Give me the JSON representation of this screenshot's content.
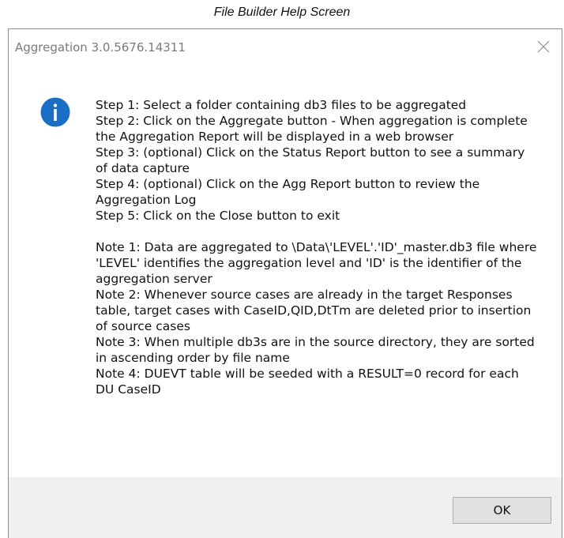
{
  "caption": "File Builder Help Screen",
  "window": {
    "title": "Aggregation 3.0.5676.14311",
    "close_icon": "close-icon"
  },
  "message": {
    "icon": "info-icon",
    "text": "Step 1: Select a folder containing db3 files to be aggregated\nStep 2: Click on the Aggregate button - When aggregation is complete the Aggregation Report will be displayed in a web browser\nStep 3: (optional) Click on the Status Report button to see a summary of data capture\nStep 4: (optional) Click on the Agg Report button to review the Aggregation Log\nStep 5: Click on the Close button to exit\n\nNote 1: Data are aggregated to \\Data\\'LEVEL'.'ID'_master.db3 file where 'LEVEL' identifies the aggregation level and 'ID' is the identifier of the aggregation server\nNote 2: Whenever source cases are already in the target Responses table, target cases with CaseID,QID,DtTm are deleted prior to insertion of source cases\nNote 3: When multiple db3s are in the source directory, they are sorted in ascending order by file name\nNote 4: DUEVT table will be seeded with a RESULT=0 record for each DU CaseID"
  },
  "buttons": {
    "ok_label": "OK"
  },
  "colors": {
    "info_icon_fill": "#1a6fc4",
    "footer_background": "#f0f0f0"
  }
}
